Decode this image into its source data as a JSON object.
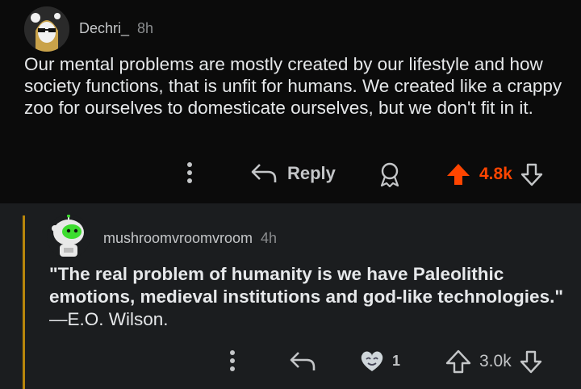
{
  "comment1": {
    "username": "Dechri_",
    "age": "8h",
    "text": "Our mental problems are mostly created by our lifestyle and how society functions, that is unfit for humans. We created like a crappy zoo for ourselves to domesticate ourselves, but we don't fit in it.",
    "reply_label": "Reply",
    "score": "4.8k",
    "upvoted": true,
    "accent_color": "#ff4500"
  },
  "comment2": {
    "username": "mushroomvroomvroom",
    "age": "4h",
    "quote_bold": "\"The real problem of humanity is we have Paleolithic emotions, medieval institutions and god-like technologies.\"",
    "quote_attr": " —E.O. Wilson.",
    "award_count": "1",
    "score": "3.0k",
    "thread_color": "#b8860b"
  },
  "icons": [
    "more-icon",
    "reply-icon",
    "award-icon",
    "upvote-icon",
    "downvote-icon"
  ]
}
